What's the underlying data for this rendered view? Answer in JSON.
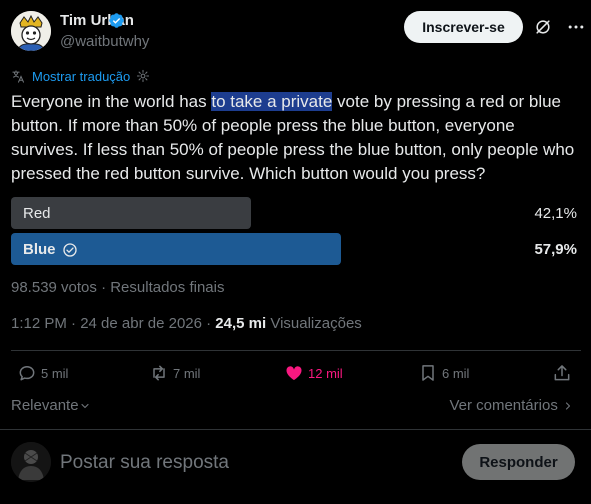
{
  "author": {
    "name": "Tim Urban",
    "handle": "@waitbutwhy"
  },
  "subscribe_label": "Inscrever-se",
  "translate_label": "Mostrar tradução",
  "tweet": {
    "text_before": "Everyone in the world has ",
    "text_highlighted": "to take a private",
    "text_after": " vote by pressing a red or blue button. If more than 50% of people press the blue button, everyone survives. If less than 50% of people press the blue button, only people who pressed the red button survive. Which button would you press?"
  },
  "poll": {
    "options": [
      {
        "label": "Red",
        "percent_label": "42,1%",
        "percent": 42.1,
        "color": "#3a3d41",
        "winner": false
      },
      {
        "label": "Blue",
        "percent_label": "57,9%",
        "percent": 57.9,
        "color": "#1d5a94",
        "winner": true
      }
    ],
    "summary": "98.539 votos · Resultados finais"
  },
  "meta": {
    "time": "1:12 PM · 24 de abr de 2026 · ",
    "views_count": "24,5 mi",
    "views_label": " Visualizações"
  },
  "actions": {
    "replies": "5 mil",
    "reposts": "7 mil",
    "likes": "12 mil",
    "bookmarks": "6 mil"
  },
  "sort": {
    "label": "Relevante",
    "view_comments": "Ver comentários"
  },
  "reply": {
    "placeholder": "Postar sua resposta",
    "button_label": "Responder"
  },
  "colors": {
    "accent": "#1d9bf0",
    "like": "#f91880",
    "highlight": "#1d3d8f"
  }
}
